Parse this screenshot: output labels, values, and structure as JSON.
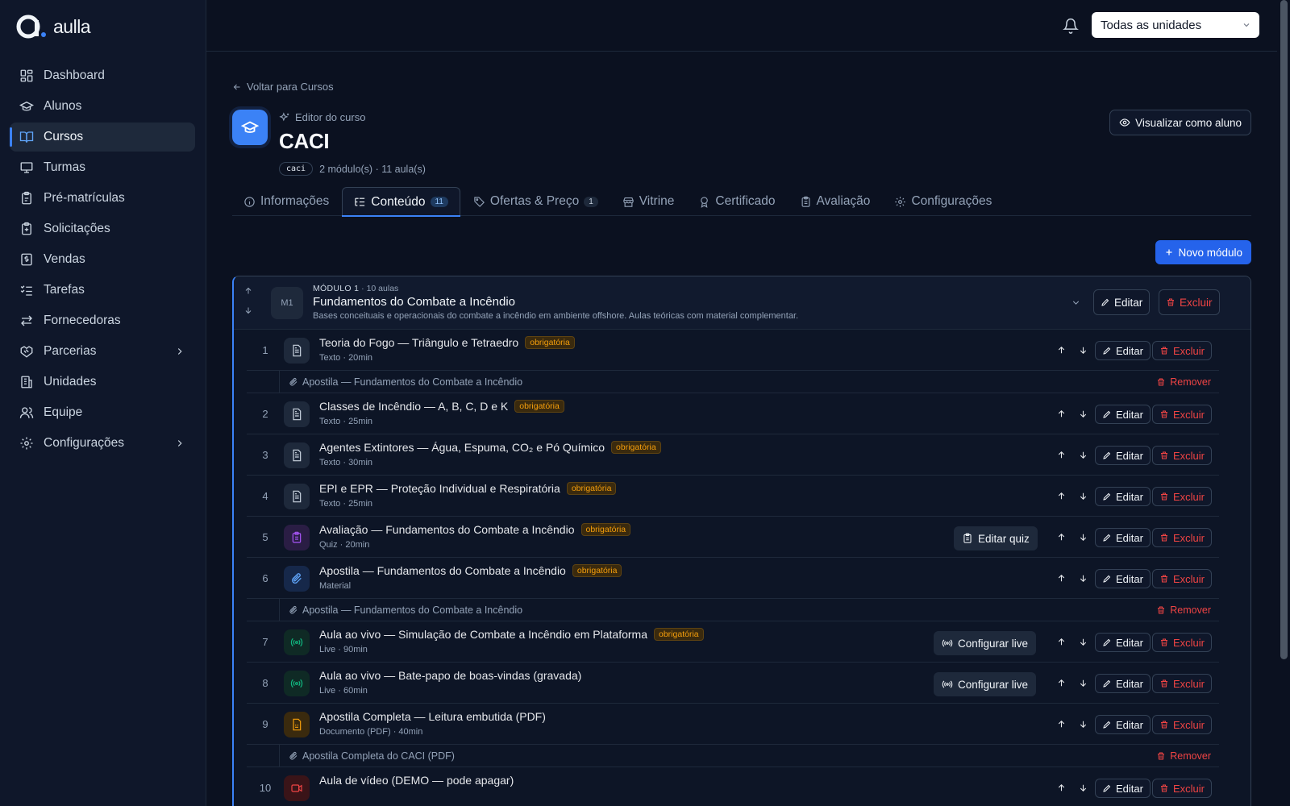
{
  "brand": {
    "name": "aulla"
  },
  "sidebar": {
    "items": [
      {
        "label": "Dashboard",
        "icon": "grid-icon"
      },
      {
        "label": "Alunos",
        "icon": "graduation-cap-icon"
      },
      {
        "label": "Cursos",
        "icon": "book-open-icon",
        "active": true
      },
      {
        "label": "Turmas",
        "icon": "presentation-icon"
      },
      {
        "label": "Pré-matrículas",
        "icon": "clipboard-icon"
      },
      {
        "label": "Solicitações",
        "icon": "clipboard-plus-icon"
      },
      {
        "label": "Vendas",
        "icon": "receipt-icon"
      },
      {
        "label": "Tarefas",
        "icon": "checklist-icon"
      },
      {
        "label": "Fornecedoras",
        "icon": "arrows-swap-icon"
      },
      {
        "label": "Parcerias",
        "icon": "handshake-icon",
        "expandable": true
      },
      {
        "label": "Unidades",
        "icon": "building-icon"
      },
      {
        "label": "Equipe",
        "icon": "users-icon"
      },
      {
        "label": "Configurações",
        "icon": "gear-icon",
        "expandable": true
      }
    ]
  },
  "topbar": {
    "unit_select": "Todas as unidades"
  },
  "header": {
    "back_label": "Voltar para Cursos",
    "editor_label": "Editor do curso",
    "title": "CACI",
    "slug": "caci",
    "meta": "2 módulo(s) · 11 aula(s)",
    "view_as_student": "Visualizar como aluno"
  },
  "tabs": [
    {
      "label": "Informações",
      "icon": "info-icon"
    },
    {
      "label": "Conteúdo",
      "icon": "list-tree-icon",
      "count": "11",
      "active": true
    },
    {
      "label": "Ofertas & Preço",
      "icon": "tag-icon",
      "count": "1"
    },
    {
      "label": "Vitrine",
      "icon": "store-icon"
    },
    {
      "label": "Certificado",
      "icon": "award-icon"
    },
    {
      "label": "Avaliação",
      "icon": "clipboard-check-icon"
    },
    {
      "label": "Configurações",
      "icon": "gear-icon"
    }
  ],
  "new_module_label": "Novo módulo",
  "module": {
    "badge": "M1",
    "kicker": "MÓDULO 1",
    "lesson_count": "· 10 aulas",
    "title": "Fundamentos do Combate a Incêndio",
    "description": "Bases conceituais e operacionais do combate a incêndio em ambiente offshore. Aulas teóricas com material complementar.",
    "edit_label": "Editar",
    "delete_label": "Excluir"
  },
  "labels": {
    "edit": "Editar",
    "delete": "Excluir",
    "remove": "Remover",
    "required": "obrigatória"
  },
  "lessons": [
    {
      "num": "1",
      "title": "Teoria do Fogo — Triângulo e Tetraedro",
      "sub": "Texto · 20min",
      "required": true,
      "kind": "text",
      "attachment": "Apostila — Fundamentos do Combate a Incêndio"
    },
    {
      "num": "2",
      "title": "Classes de Incêndio — A, B, C, D e K",
      "sub": "Texto · 25min",
      "required": true,
      "kind": "text"
    },
    {
      "num": "3",
      "title": "Agentes Extintores — Água, Espuma, CO₂ e Pó Químico",
      "sub": "Texto · 30min",
      "required": true,
      "kind": "text"
    },
    {
      "num": "4",
      "title": "EPI e EPR — Proteção Individual e Respiratória",
      "sub": "Texto · 25min",
      "required": true,
      "kind": "text"
    },
    {
      "num": "5",
      "title": "Avaliação — Fundamentos do Combate a Incêndio",
      "sub": "Quiz · 20min",
      "required": true,
      "kind": "quiz",
      "action": "Editar quiz"
    },
    {
      "num": "6",
      "title": "Apostila — Fundamentos do Combate a Incêndio",
      "sub": "Material",
      "required": true,
      "kind": "material",
      "attachment": "Apostila — Fundamentos do Combate a Incêndio"
    },
    {
      "num": "7",
      "title": "Aula ao vivo — Simulação de Combate a Incêndio em Plataforma",
      "sub": "Live · 90min",
      "required": true,
      "kind": "live",
      "action": "Configurar live"
    },
    {
      "num": "8",
      "title": "Aula ao vivo — Bate-papo de boas-vindas (gravada)",
      "sub": "Live · 60min",
      "required": false,
      "kind": "live",
      "action": "Configurar live"
    },
    {
      "num": "9",
      "title": "Apostila Completa — Leitura embutida (PDF)",
      "sub": "Documento (PDF) · 40min",
      "required": false,
      "kind": "pdf",
      "attachment": "Apostila Completa do CACI (PDF)"
    },
    {
      "num": "10",
      "title": "Aula de vídeo (DEMO — pode apagar)",
      "sub": "",
      "required": false,
      "kind": "video"
    }
  ],
  "colors": {
    "accent": "#3b82f6",
    "danger": "#ef4444",
    "warning": "#f59e0b",
    "quiz": "#a855f7",
    "live": "#10b981",
    "pdf": "#f59e0b",
    "video": "#ef4444"
  }
}
